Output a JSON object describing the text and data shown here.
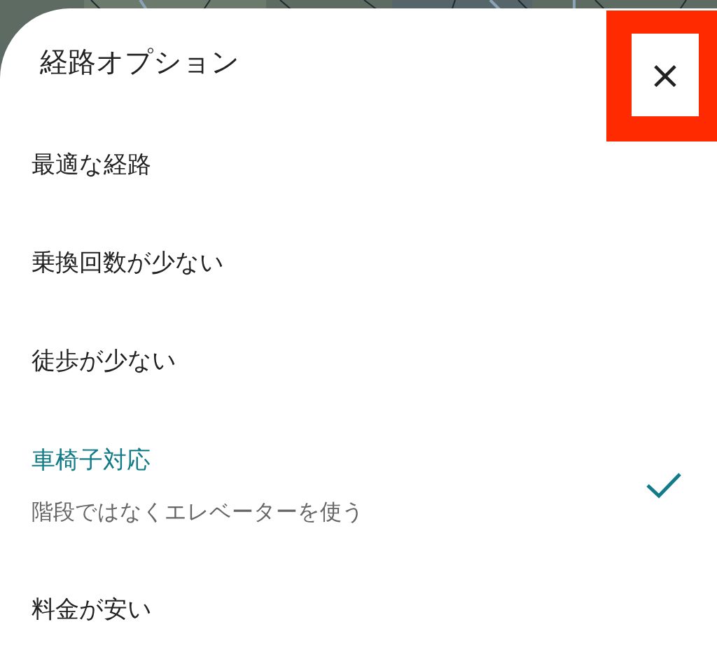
{
  "sheet": {
    "title": "経路オプション",
    "close_button": {
      "label": "×",
      "highlighted": true
    }
  },
  "options": [
    {
      "label": "最適な経路",
      "selected": false
    },
    {
      "label": "乗換回数が少ない",
      "selected": false
    },
    {
      "label": "徒歩が少ない",
      "selected": false
    },
    {
      "label": "車椅子対応",
      "description": "階段ではなくエレベーターを使う",
      "selected": true
    },
    {
      "label": "料金が安い",
      "selected": false
    }
  ]
}
